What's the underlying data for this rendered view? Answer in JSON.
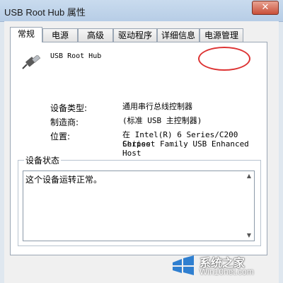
{
  "window": {
    "title": "USB Root Hub 属性",
    "close_icon": "close-icon"
  },
  "tabs": [
    {
      "label": "常规",
      "active": true
    },
    {
      "label": "电源",
      "active": false
    },
    {
      "label": "高级",
      "active": false
    },
    {
      "label": "驱动程序",
      "active": false
    },
    {
      "label": "详细信息",
      "active": false
    },
    {
      "label": "电源管理",
      "active": false
    }
  ],
  "general": {
    "device_name": "USB Root Hub",
    "device_icon": "usb-plug-icon",
    "rows": [
      {
        "label": "设备类型:",
        "value": "通用串行总线控制器"
      },
      {
        "label": "制造商:",
        "value": "(标准 USB 主控制器)"
      },
      {
        "label": "位置:",
        "value": "在 Intel(R) 6 Series/C200 Series",
        "value2": "Chipset Family USB Enhanced Host"
      }
    ],
    "status": {
      "legend": "设备状态",
      "text": "这个设备运转正常。"
    }
  },
  "watermark": {
    "line1": "系统之家",
    "line2": "Win10net.com",
    "icon": "windows-logo-icon"
  },
  "colors": {
    "highlight": "#dd3333",
    "titlebar": "#c9dbee"
  }
}
